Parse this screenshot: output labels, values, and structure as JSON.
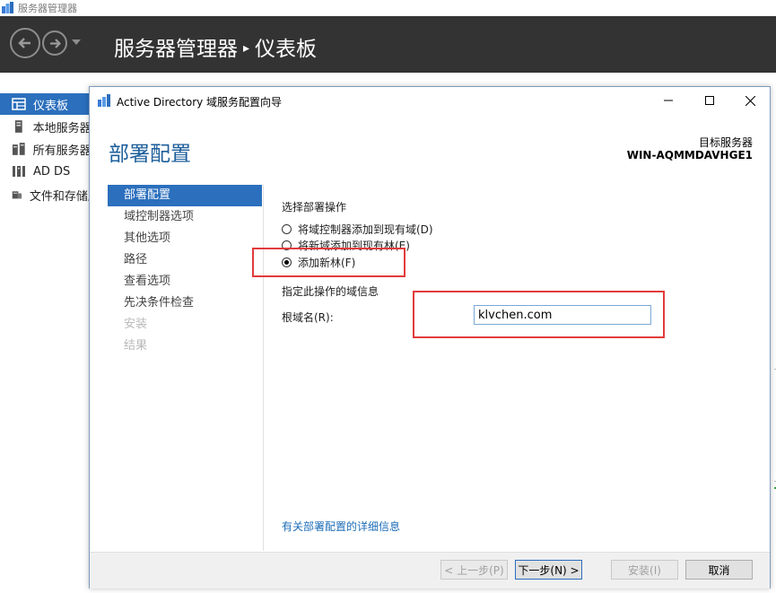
{
  "server_manager": {
    "window_title": "服务器管理器",
    "breadcrumb_root": "服务器管理器",
    "breadcrumb_separator": "▸",
    "breadcrumb_current": "仪表板",
    "sidebar": {
      "items": [
        {
          "label": "仪表板",
          "icon": "dashboard-icon",
          "active": true
        },
        {
          "label": "本地服务器",
          "icon": "local-server-icon"
        },
        {
          "label": "所有服务器",
          "icon": "all-servers-icon"
        },
        {
          "label": "AD DS",
          "icon": "ad-ds-icon"
        },
        {
          "label": "文件和存储服务",
          "icon": "file-storage-icon"
        }
      ]
    }
  },
  "dialog": {
    "title": "Active Directory 域服务配置向导",
    "heading": "部署配置",
    "target_server_label": "目标服务器",
    "target_server_value": "WIN-AQMMDAVHGE1",
    "steps": [
      {
        "label": "部署配置",
        "state": "active"
      },
      {
        "label": "域控制器选项",
        "state": "normal"
      },
      {
        "label": "其他选项",
        "state": "normal"
      },
      {
        "label": "路径",
        "state": "normal"
      },
      {
        "label": "查看选项",
        "state": "normal"
      },
      {
        "label": "先决条件检查",
        "state": "normal"
      },
      {
        "label": "安装",
        "state": "disabled"
      },
      {
        "label": "结果",
        "state": "disabled"
      }
    ],
    "select_operation_label": "选择部署操作",
    "options": [
      {
        "label": "将域控制器添加到现有域(D)",
        "selected": false
      },
      {
        "label": "将新域添加到现有林(E)",
        "selected": false
      },
      {
        "label": "添加新林(F)",
        "selected": true
      }
    ],
    "domain_info_label": "指定此操作的域信息",
    "root_domain_label": "根域名(R):",
    "root_domain_value": "klvchen.com",
    "help_link": "有关部署配置的详细信息",
    "buttons": {
      "previous": "< 上一步(P)",
      "next": "下一步(N) >",
      "install": "安装(I)",
      "cancel": "取消"
    }
  },
  "colors": {
    "header_bg": "#333333",
    "accent": "#2b6fbd",
    "heading_blue": "#1c5e9b",
    "highlight_red": "#e23b3b"
  }
}
